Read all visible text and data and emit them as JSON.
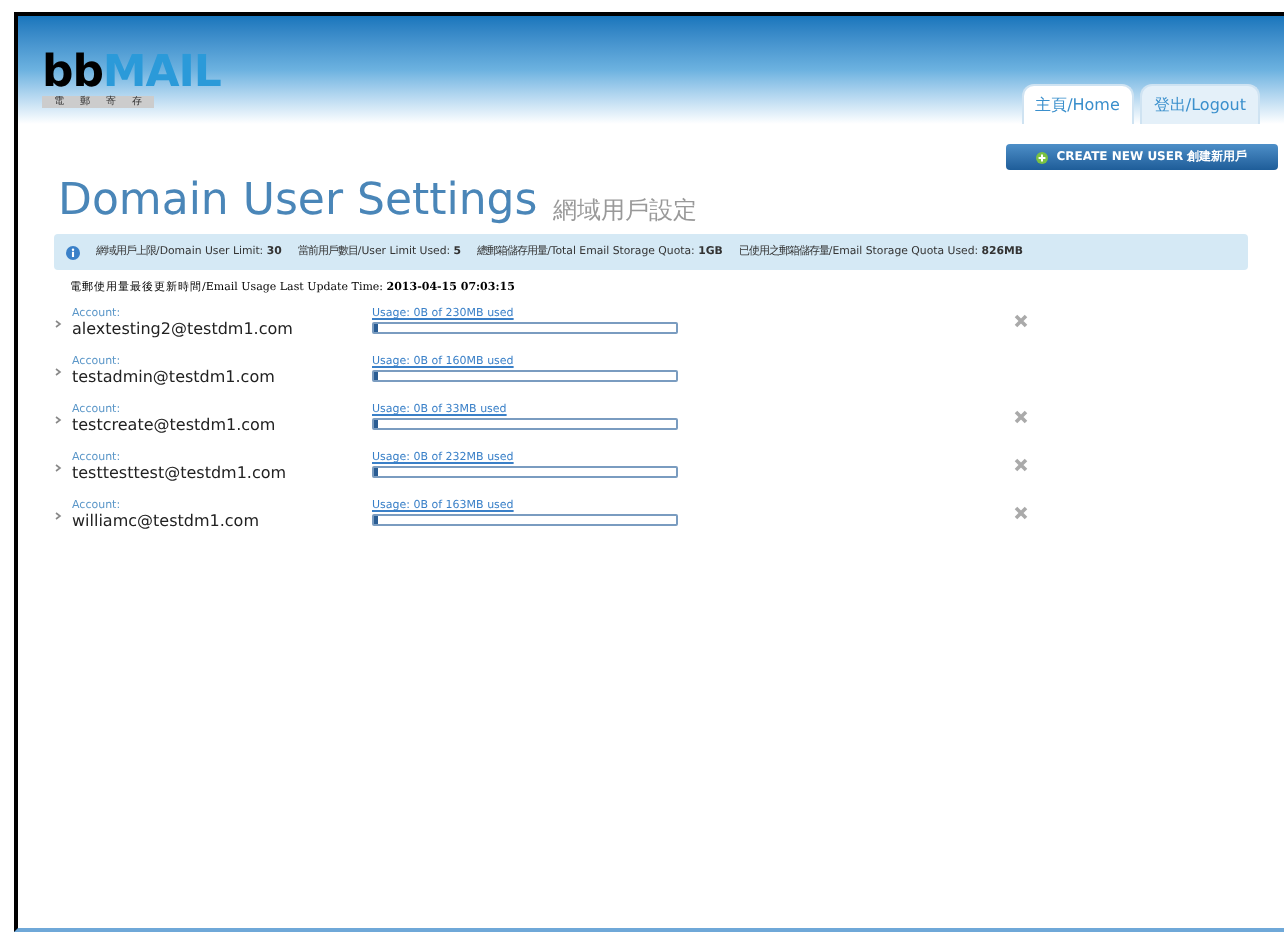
{
  "logo": {
    "brand_dark": "bb",
    "brand_light": "MAIL",
    "tagline": [
      "電",
      "郵",
      "寄",
      "存"
    ]
  },
  "nav_tabs": [
    {
      "label": "主頁/Home",
      "selected": true
    },
    {
      "label": "登出/Logout",
      "selected": false
    }
  ],
  "create_button": {
    "label": "CREATE NEW USER 創建新用戶"
  },
  "title": "Domain User Settings",
  "subtitle": "網域用戶設定",
  "summary": [
    {
      "label": "網域用戶上限/Domain User Limit:",
      "value": "30"
    },
    {
      "label": "當前用戶數目/User Limit Used:",
      "value": "5"
    },
    {
      "label": "總郵箱儲存用量/Total Email Storage Quota:",
      "value": "1GB"
    },
    {
      "label": "已使用之郵箱儲存量/Email Storage Quota Used:",
      "value": "826MB"
    }
  ],
  "update_time": {
    "label": "電郵使用量最後更新時間/Email Usage Last Update Time:",
    "value": "2013-04-15 07:03:15"
  },
  "accounts": [
    {
      "caption": "Account:",
      "email": "alextesting2@testdm1.com",
      "usage": "Usage: 0B of 230MB used",
      "level": 0.01,
      "deletable": true
    },
    {
      "caption": "Account:",
      "email": "testadmin@testdm1.com",
      "usage": "Usage: 0B of 160MB used",
      "level": 0.01,
      "deletable": false
    },
    {
      "caption": "Account:",
      "email": "testcreate@testdm1.com",
      "usage": "Usage: 0B of 33MB used",
      "level": 0.01,
      "deletable": true
    },
    {
      "caption": "Account:",
      "email": "testtesttest@testdm1.com",
      "usage": "Usage: 0B of 232MB used",
      "level": 0.01,
      "deletable": true
    },
    {
      "caption": "Account:",
      "email": "williamc@testdm1.com",
      "usage": "Usage: 0B of 163MB used",
      "level": 0.01,
      "deletable": true
    }
  ]
}
